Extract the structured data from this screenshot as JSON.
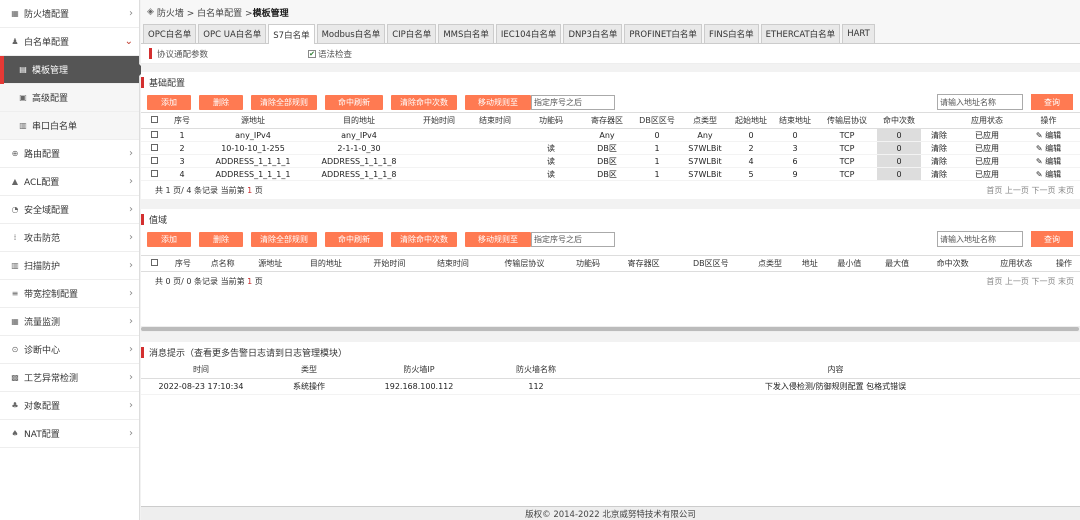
{
  "sidebar": {
    "items": [
      {
        "icon": "firewall-icon",
        "glyph": "▦",
        "label": "防火墙配置",
        "type": "parent",
        "chev": "›"
      },
      {
        "icon": "whitelist-icon",
        "glyph": "♟",
        "label": "白名单配置",
        "type": "parent-open",
        "chev": "⌄"
      },
      {
        "icon": "template-icon",
        "glyph": "▤",
        "label": "模板管理",
        "type": "sub-active"
      },
      {
        "icon": "advanced-icon",
        "glyph": "▣",
        "label": "高级配置",
        "type": "sub"
      },
      {
        "icon": "serial-icon",
        "glyph": "▥",
        "label": "串口白名单",
        "type": "sub"
      },
      {
        "icon": "route-icon",
        "glyph": "⊕",
        "label": "路由配置",
        "type": "parent",
        "chev": "›"
      },
      {
        "icon": "acl-icon",
        "glyph": "▲",
        "label": "ACL配置",
        "type": "parent",
        "chev": "›"
      },
      {
        "icon": "security-zone-icon",
        "glyph": "◔",
        "label": "安全域配置",
        "type": "parent",
        "chev": "›"
      },
      {
        "icon": "attack-defense-icon",
        "glyph": "⁞",
        "label": "攻击防范",
        "type": "parent",
        "chev": "›"
      },
      {
        "icon": "scan-defense-icon",
        "glyph": "▥",
        "label": "扫描防护",
        "type": "parent",
        "chev": "›"
      },
      {
        "icon": "bandwidth-icon",
        "glyph": "≡",
        "label": "带宽控制配置",
        "type": "parent",
        "chev": "›"
      },
      {
        "icon": "traffic-monitor-icon",
        "glyph": "▦",
        "label": "流量监测",
        "type": "parent",
        "chev": "›"
      },
      {
        "icon": "diagnosis-icon",
        "glyph": "⊙",
        "label": "诊断中心",
        "type": "parent",
        "chev": "›"
      },
      {
        "icon": "process-anomaly-icon",
        "glyph": "▩",
        "label": "工艺异常检测",
        "type": "parent",
        "chev": "›"
      },
      {
        "icon": "object-config-icon",
        "glyph": "♣",
        "label": "对象配置",
        "type": "parent",
        "chev": "›"
      },
      {
        "icon": "nat-icon",
        "glyph": "♠",
        "label": "NAT配置",
        "type": "parent",
        "chev": "›"
      }
    ]
  },
  "breadcrumb": {
    "icon": "shield-icon",
    "glyph": "◈",
    "path": "防火墙 > 白名单配置 > ",
    "current": "模板管理"
  },
  "tabs": [
    "OPC白名单",
    "OPC UA白名单",
    "S7白名单",
    "Modbus白名单",
    "CIP白名单",
    "MMS白名单",
    "IEC104白名单",
    "DNP3白名单",
    "PROFINET白名单",
    "FINS白名单",
    "ETHERCAT白名单",
    "HART"
  ],
  "active_tab": 2,
  "protocol_params": {
    "label": "协议通配参数",
    "syntax_check_label": "语法检查",
    "syntax_check_checked": true
  },
  "basic": {
    "title": "基础配置",
    "buttons": [
      "添加",
      "删除",
      "清除全部规则",
      "命中刷新",
      "清除命中次数",
      "移动规则至"
    ],
    "position_placeholder": "指定序号之后",
    "search_placeholder": "请输入地址名称",
    "search_label": "查询",
    "columns": [
      "",
      "序号",
      "源地址",
      "目的地址",
      "开始时间",
      "结束时间",
      "功能码",
      "寄存器区",
      "DB区区号",
      "点类型",
      "起始地址",
      "结束地址",
      "传输层协议",
      "命中次数",
      "",
      "应用状态",
      "操作"
    ],
    "rows": [
      [
        "1",
        "any_IPv4",
        "any_IPv4",
        "",
        "",
        "",
        "Any",
        "0",
        "Any",
        "0",
        "0",
        "TCP",
        "0",
        "清除",
        "已应用",
        "编辑"
      ],
      [
        "2",
        "10-10-10_1-255",
        "2-1-1-0_30",
        "",
        "",
        "读",
        "DB区",
        "1",
        "S7WLBit",
        "2",
        "3",
        "TCP",
        "0",
        "清除",
        "已应用",
        "编辑"
      ],
      [
        "3",
        "ADDRESS_1_1_1_1",
        "ADDRESS_1_1_1_8",
        "",
        "",
        "读",
        "DB区",
        "1",
        "S7WLBit",
        "4",
        "6",
        "TCP",
        "0",
        "清除",
        "已应用",
        "编辑"
      ],
      [
        "4",
        "ADDRESS_1_1_1_1",
        "ADDRESS_1_1_1_8",
        "",
        "",
        "读",
        "DB区",
        "1",
        "S7WLBit",
        "5",
        "9",
        "TCP",
        "0",
        "清除",
        "已应用",
        "编辑"
      ]
    ],
    "pager_left_prefix": "共 1 页/ 4 条记录 当前第 ",
    "pager_page": "1",
    "pager_left_suffix": " 页",
    "pager_right": "首页 上一页 下一页 末页"
  },
  "range": {
    "title": "值域",
    "buttons": [
      "添加",
      "删除",
      "清除全部规则",
      "命中刷新",
      "清除命中次数",
      "移动规则至"
    ],
    "position_placeholder": "指定序号之后",
    "search_placeholder": "请输入地址名称",
    "search_label": "查询",
    "columns": [
      "",
      "序号",
      "点名称",
      "源地址",
      "目的地址",
      "开始时间",
      "结束时间",
      "传输层协议",
      "功能码",
      "寄存器区",
      "DB区区号",
      "点类型",
      "地址",
      "最小值",
      "最大值",
      "命中次数",
      "应用状态",
      "操作"
    ],
    "pager_left_prefix": "共 0 页/ 0 条记录 当前第 ",
    "pager_page": "1",
    "pager_left_suffix": " 页",
    "pager_right": "首页 上一页 下一页 末页"
  },
  "messages": {
    "title": "消息提示（查看更多告警日志请到日志管理模块）",
    "columns": [
      "时间",
      "类型",
      "防火墙IP",
      "防火墙名称",
      "内容"
    ],
    "rows": [
      [
        "2022-08-23 17:10:34",
        "系统操作",
        "192.168.100.112",
        "112",
        "下发入侵检测/防御规则配置 包格式错误"
      ]
    ]
  },
  "footer": "版权© 2014-2022 北京威努特技术有限公司"
}
